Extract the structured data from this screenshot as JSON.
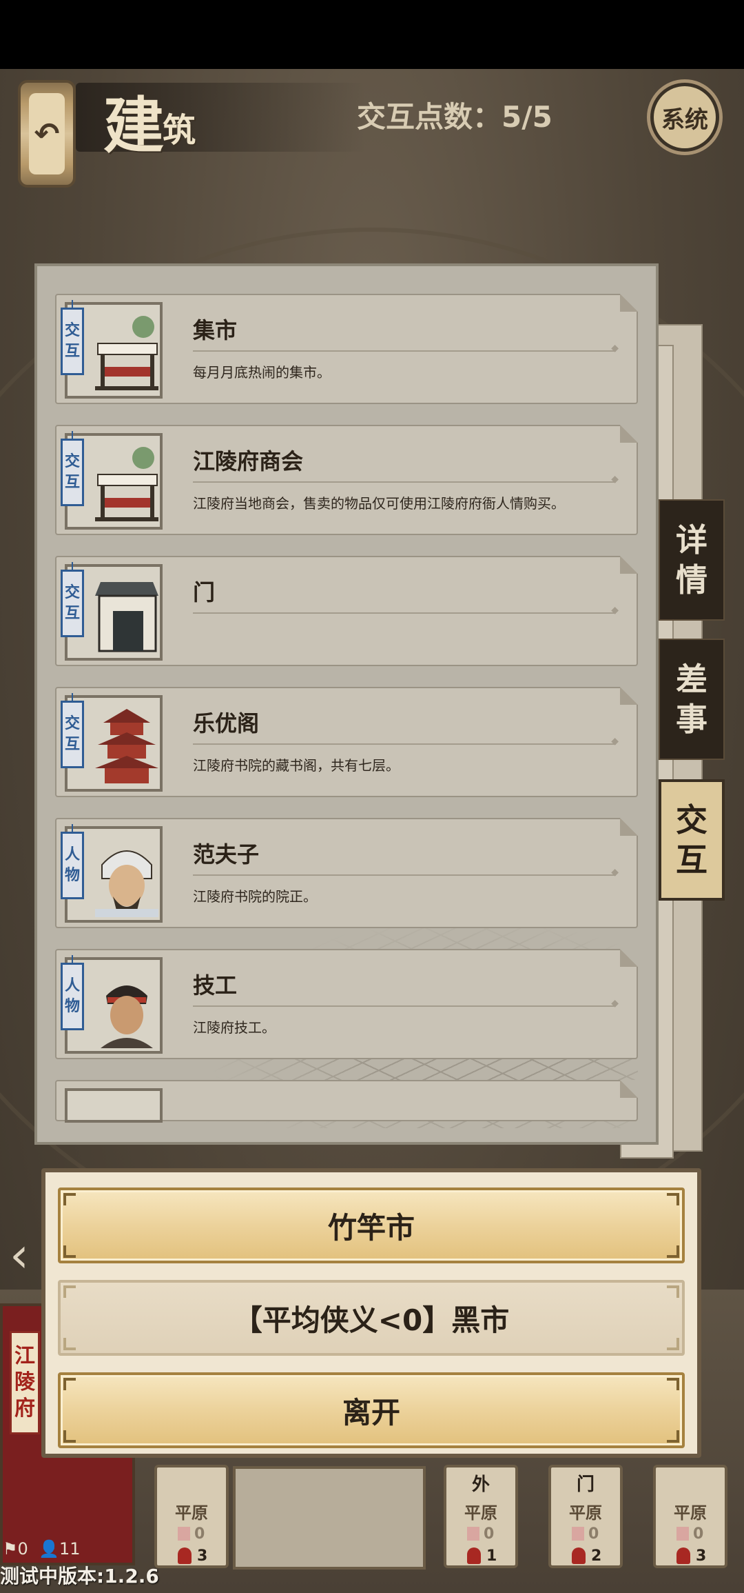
{
  "header": {
    "back_icon": "↶",
    "title_main": "建",
    "title_small": "筑",
    "interaction_points": "交互点数：5/5",
    "system_label": "系统"
  },
  "side_tabs": [
    {
      "label_1": "详",
      "label_2": "情"
    },
    {
      "label_1": "差",
      "label_2": "事"
    },
    {
      "label_1": "交",
      "label_2": "互",
      "active": true
    }
  ],
  "items": [
    {
      "tag_1": "交",
      "tag_2": "互",
      "name": "集市",
      "desc": "每月月底热闹的集市。",
      "art": "market"
    },
    {
      "tag_1": "交",
      "tag_2": "互",
      "name": "江陵府商会",
      "desc": "江陵府当地商会，售卖的物品仅可使用江陵府府衙人情购买。",
      "art": "market"
    },
    {
      "tag_1": "交",
      "tag_2": "互",
      "name": "门",
      "desc": "",
      "art": "gate"
    },
    {
      "tag_1": "交",
      "tag_2": "互",
      "name": "乐优阁",
      "desc": "江陵府书院的藏书阁，共有七层。",
      "art": "pavilion"
    },
    {
      "tag_1": "人",
      "tag_2": "物",
      "name": "范夫子",
      "desc": "江陵府书院的院正。",
      "art": "scholar"
    },
    {
      "tag_1": "人",
      "tag_2": "物",
      "name": "技工",
      "desc": "江陵府技工。",
      "art": "worker"
    }
  ],
  "dialog": {
    "options": [
      {
        "label": "竹竿市",
        "style": "gold"
      },
      {
        "label": "【平均侠义<0】黑市",
        "style": "dim"
      },
      {
        "label": "离开",
        "style": "gold"
      }
    ]
  },
  "bottom": {
    "city": {
      "l1": "江",
      "l2": "陵",
      "l3": "府",
      "flags": "0",
      "people": "11"
    },
    "cards": [
      {
        "top": "",
        "label": "平原",
        "n0": "0",
        "n1": "3"
      },
      {
        "top": "外",
        "label": "平原",
        "n0": "0",
        "n1": "1"
      },
      {
        "top": "门",
        "label": "平原",
        "n0": "0",
        "n1": "2"
      },
      {
        "top": "",
        "label": "平原",
        "n0": "0",
        "n1": "3"
      }
    ]
  },
  "version": "测试中版本:1.2.6"
}
